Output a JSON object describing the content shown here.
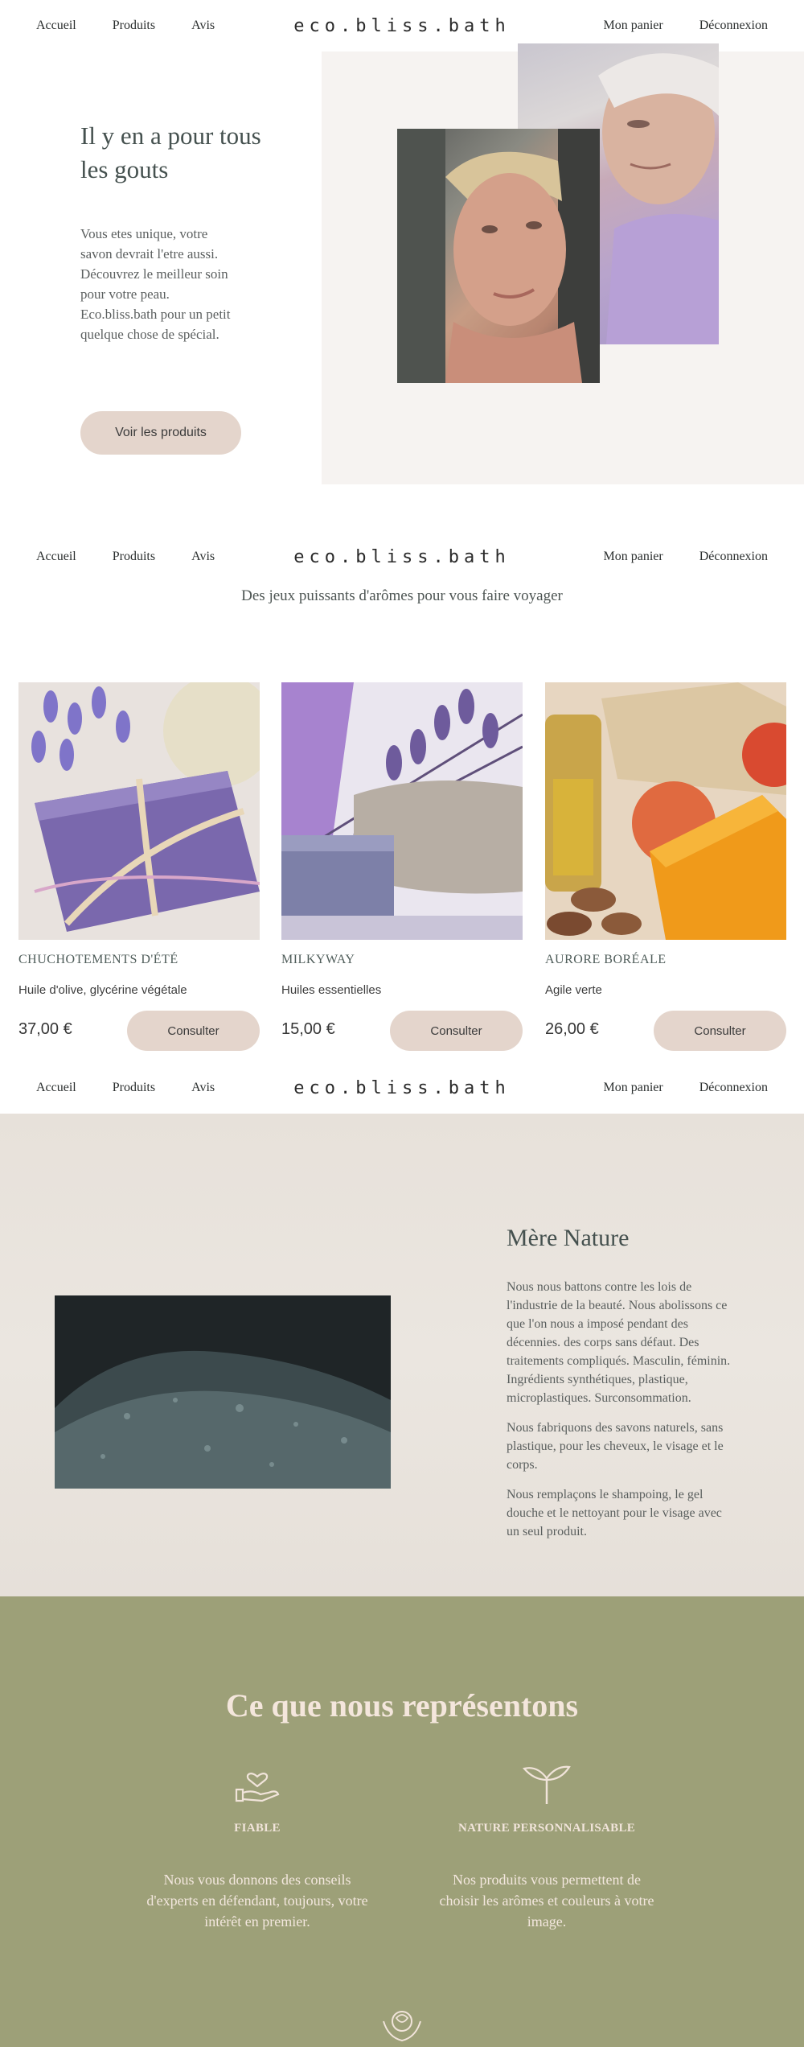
{
  "brand": {
    "logo": "eco.bliss.bath"
  },
  "nav": {
    "left": [
      "Accueil",
      "Produits",
      "Avis"
    ],
    "right": [
      "Mon panier",
      "Déconnexion"
    ]
  },
  "hero": {
    "title": "Il y en a pour tous les gouts",
    "text": "Vous etes unique, votre savon devrait l'etre aussi. Découvrez le meilleur soin pour votre peau. Eco.bliss.bath pour un petit quelque chose de spécial.",
    "button": "Voir les produits"
  },
  "products": {
    "tagline": "Des jeux puissants d'arômes pour vous faire voyager",
    "items": [
      {
        "name": "Chuchotements d'été",
        "description": "Huile d'olive, glycérine végétale",
        "price": "37,00 €",
        "button": "Consulter"
      },
      {
        "name": "Milkyway",
        "description": "Huiles essentielles",
        "price": "15,00 €",
        "button": "Consulter"
      },
      {
        "name": "Aurore Boréale",
        "description": "Agile verte",
        "price": "26,00 €",
        "button": "Consulter"
      }
    ]
  },
  "nature": {
    "title": "Mère Nature",
    "paragraphs": [
      "Nous nous battons contre les lois de l'industrie de la beauté. Nous abolissons ce que l'on nous a imposé pendant des décennies. des corps sans défaut. Des traitements compliqués. Masculin, féminin. Ingrédients synthétiques, plastique, microplastiques. Surconsommation.",
      "Nous fabriquons des savons naturels, sans plastique, pour les cheveux, le visage et le corps.",
      "Nous remplaçons le shampoing, le gel douche et le nettoyant pour le visage avec un seul produit."
    ]
  },
  "values": {
    "title": "Ce que nous représentons",
    "items": [
      {
        "icon": "heart-hand-icon",
        "heading": "FIABLE",
        "text": "Nous vous donnons des conseils d'experts en défendant, toujours, votre intérêt en premier."
      },
      {
        "icon": "sprout-icon",
        "heading": "NATURE PERSONNALISABLE",
        "text": "Nos produits vous permettent de choisir les arômes et couleurs à votre image."
      }
    ],
    "bottom_icon": "rose-hand-icon"
  },
  "colors": {
    "button": "#e4d5cc",
    "hero_panel": "#f6f3f1",
    "nature_bg": "#e9e3dc",
    "values_bg": "#9da078",
    "values_text": "#f4e6dc"
  }
}
